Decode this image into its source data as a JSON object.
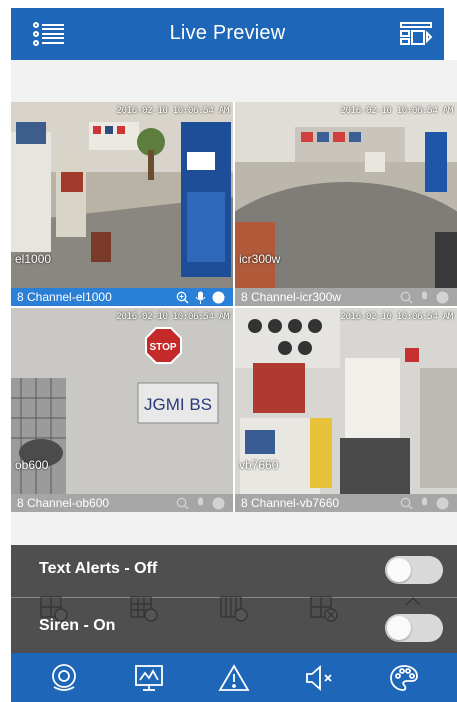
{
  "header": {
    "title": "Live Preview",
    "menu_icon": "list-menu-icon",
    "layout_icon": "channel-layout-icon"
  },
  "cameras": [
    {
      "tag": "el1000",
      "channel_label": "8 Channel-el1000",
      "timestamp": "2016-02-10 10:06:54 AM",
      "selected": true
    },
    {
      "tag": "icr300w",
      "channel_label": "8 Channel-icr300w",
      "timestamp": "2016-02-10 10:06:54 AM",
      "selected": false
    },
    {
      "tag": "ob600",
      "channel_label": "8 Channel-ob600",
      "timestamp": "2016-02-10 10:06:54 AM",
      "selected": false
    },
    {
      "tag": "vb7660",
      "channel_label": "8 Channel-vb7660",
      "timestamp": "2016-02-10 10:06:54 AM",
      "selected": false
    }
  ],
  "panel": {
    "text_alerts": {
      "label": "Text Alerts - Off",
      "on": false
    },
    "siren": {
      "label": "Siren - On",
      "on": false
    },
    "layout_options": [
      "4",
      "9",
      "16",
      "close"
    ]
  },
  "footer": {
    "items": [
      "surveillance-eye-icon",
      "playback-monitor-icon",
      "alert-icon",
      "mute-icon",
      "palette-icon"
    ]
  },
  "colors": {
    "brand": "#1e66b8",
    "active_bar": "#2a80d6"
  }
}
